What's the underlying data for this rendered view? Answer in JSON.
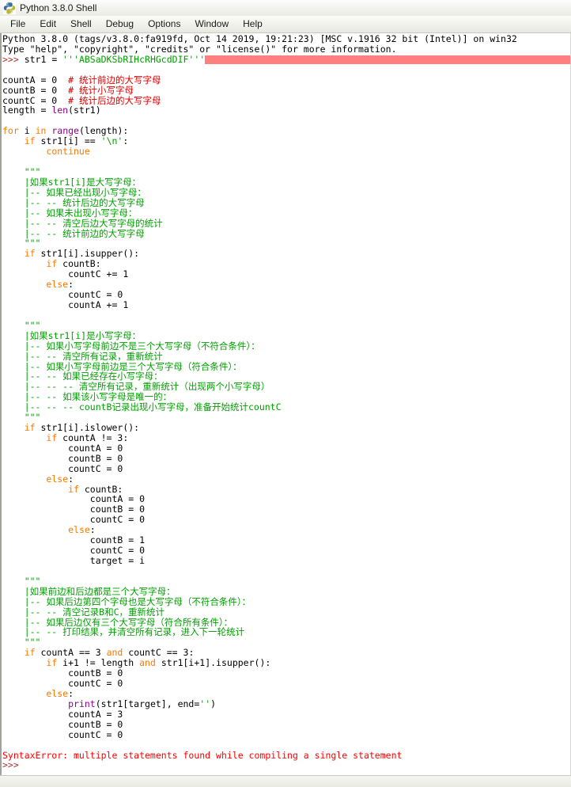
{
  "window": {
    "title": "Python 3.8.0 Shell",
    "icon": "python-logo-icon"
  },
  "menubar": {
    "items": [
      {
        "label": "File",
        "name": "menu-file"
      },
      {
        "label": "Edit",
        "name": "menu-edit"
      },
      {
        "label": "Shell",
        "name": "menu-shell"
      },
      {
        "label": "Debug",
        "name": "menu-debug"
      },
      {
        "label": "Options",
        "name": "menu-options"
      },
      {
        "label": "Window",
        "name": "menu-window"
      },
      {
        "label": "Help",
        "name": "menu-help"
      }
    ]
  },
  "colors": {
    "keyword": "#ff7700",
    "builtin": "#900090",
    "string": "#00a000",
    "comment": "#dd0000",
    "error": "#ff0000",
    "prompt": "#aa3333",
    "error_highlight": "#ff7f7f",
    "background": "#ffffff"
  },
  "shell": {
    "banner_line_1": "Python 3.8.0 (tags/v3.8.0:fa919fd, Oct 14 2019, 19:21:23) [MSC v.1916 32 bit (Intel)] on win32",
    "banner_line_2": "Type \"help\", \"copyright\", \"credits\" or \"license()\" for more information.",
    "prompt": ">>>",
    "input_statement": "str1 = ",
    "input_string_literal": "'''ABSaDKSbRIHcRHGcdDIF'''",
    "error_message": "SyntaxError: multiple statements found while compiling a single statement",
    "final_prompt": ">>>",
    "code": [
      {
        "t": "code",
        "text": "countA = 0  ",
        "comment": "# 统计前边的大写字母"
      },
      {
        "t": "code",
        "text": "countB = 0  ",
        "comment": "# 统计小写字母"
      },
      {
        "t": "code",
        "text": "countC = 0  ",
        "comment": "# 统计后边的大写字母"
      },
      {
        "t": "code",
        "text": "length = len(str1)"
      },
      {
        "t": "blank",
        "text": ""
      },
      {
        "t": "code",
        "text": "for i in range(length):"
      },
      {
        "t": "code",
        "text": "    if str1[i] == '\\n':"
      },
      {
        "t": "code",
        "text": "        continue"
      },
      {
        "t": "blank",
        "text": ""
      },
      {
        "t": "doc",
        "text": "    \"\"\""
      },
      {
        "t": "doc",
        "text": "    |如果str1[i]是大写字母："
      },
      {
        "t": "doc",
        "text": "    |-- 如果已经出现小写字母："
      },
      {
        "t": "doc",
        "text": "    |-- -- 统计后边的大写字母"
      },
      {
        "t": "doc",
        "text": "    |-- 如果未出现小写字母："
      },
      {
        "t": "doc",
        "text": "    |-- -- 清空后边大写字母的统计"
      },
      {
        "t": "doc",
        "text": "    |-- -- 统计前边的大写字母"
      },
      {
        "t": "doc",
        "text": "    \"\"\""
      },
      {
        "t": "code",
        "text": "    if str1[i].isupper():"
      },
      {
        "t": "code",
        "text": "        if countB:"
      },
      {
        "t": "code",
        "text": "            countC += 1"
      },
      {
        "t": "code",
        "text": "        else:"
      },
      {
        "t": "code",
        "text": "            countC = 0"
      },
      {
        "t": "code",
        "text": "            countA += 1"
      },
      {
        "t": "blank",
        "text": ""
      },
      {
        "t": "doc",
        "text": "    \"\"\""
      },
      {
        "t": "doc",
        "text": "    |如果str1[i]是小写字母："
      },
      {
        "t": "doc",
        "text": "    |-- 如果小写字母前边不是三个大写字母（不符合条件）："
      },
      {
        "t": "doc",
        "text": "    |-- -- 清空所有记录，重新统计"
      },
      {
        "t": "doc",
        "text": "    |-- 如果小写字母前边是三个大写字母（符合条件）："
      },
      {
        "t": "doc",
        "text": "    |-- -- 如果已经存在小写字母："
      },
      {
        "t": "doc",
        "text": "    |-- -- -- 清空所有记录，重新统计（出现两个小写字母）"
      },
      {
        "t": "doc",
        "text": "    |-- -- 如果该小写字母是唯一的："
      },
      {
        "t": "doc",
        "text": "    |-- -- -- countB记录出现小写字母，准备开始统计countC"
      },
      {
        "t": "doc",
        "text": "    \"\"\""
      },
      {
        "t": "code",
        "text": "    if str1[i].islower():"
      },
      {
        "t": "code",
        "text": "        if countA != 3:"
      },
      {
        "t": "code",
        "text": "            countA = 0"
      },
      {
        "t": "code",
        "text": "            countB = 0"
      },
      {
        "t": "code",
        "text": "            countC = 0"
      },
      {
        "t": "code",
        "text": "        else:"
      },
      {
        "t": "code",
        "text": "            if countB:"
      },
      {
        "t": "code",
        "text": "                countA = 0"
      },
      {
        "t": "code",
        "text": "                countB = 0"
      },
      {
        "t": "code",
        "text": "                countC = 0"
      },
      {
        "t": "code",
        "text": "            else:"
      },
      {
        "t": "code",
        "text": "                countB = 1"
      },
      {
        "t": "code",
        "text": "                countC = 0"
      },
      {
        "t": "code",
        "text": "                target = i"
      },
      {
        "t": "blank",
        "text": ""
      },
      {
        "t": "doc",
        "text": "    \"\"\""
      },
      {
        "t": "doc",
        "text": "    |如果前边和后边都是三个大写字母："
      },
      {
        "t": "doc",
        "text": "    |-- 如果后边第四个字母也是大写字母（不符合条件）："
      },
      {
        "t": "doc",
        "text": "    |-- -- 清空记录B和C，重新统计"
      },
      {
        "t": "doc",
        "text": "    |-- 如果后边仅有三个大写字母（符合所有条件）："
      },
      {
        "t": "doc",
        "text": "    |-- -- 打印结果，并清空所有记录，进入下一轮统计"
      },
      {
        "t": "doc",
        "text": "    \"\"\""
      },
      {
        "t": "code",
        "text": "    if countA == 3 and countC == 3:"
      },
      {
        "t": "code",
        "text": "        if i+1 != length and str1[i+1].isupper():"
      },
      {
        "t": "code",
        "text": "            countB = 0"
      },
      {
        "t": "code",
        "text": "            countC = 0"
      },
      {
        "t": "code",
        "text": "        else:"
      },
      {
        "t": "code",
        "text": "            print(str1[target], end='')"
      },
      {
        "t": "code",
        "text": "            countA = 3"
      },
      {
        "t": "code",
        "text": "            countB = 0"
      },
      {
        "t": "code",
        "text": "            countC = 0"
      }
    ]
  }
}
